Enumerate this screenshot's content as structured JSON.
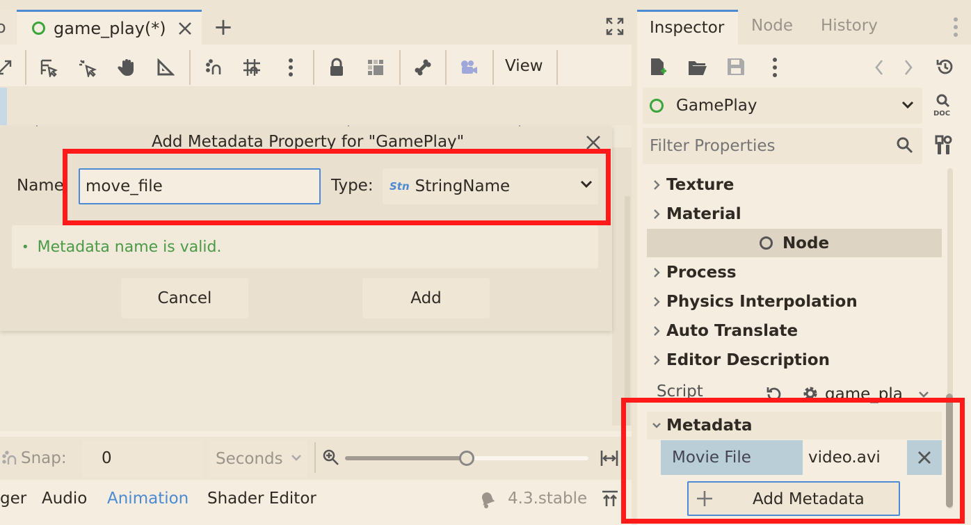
{
  "tabs": {
    "scene_tab": "game_play(*)",
    "add_tab": "+"
  },
  "toolbar": {
    "view_label": "View"
  },
  "dialog": {
    "title": "Add Metadata Property for \"GamePlay\"",
    "name_label": "Name:",
    "name_value": "move_file",
    "type_label": "Type:",
    "type_value": "StringName",
    "validation": "Metadata name is valid.",
    "cancel": "Cancel",
    "add": "Add"
  },
  "animation_bar": {
    "snap_label": "Snap:",
    "snap_value": "0",
    "unit": "Seconds"
  },
  "bottom_tabs": [
    "ger",
    "Audio",
    "Animation",
    "Shader Editor"
  ],
  "version": "4.3.stable",
  "inspector": {
    "tabs": [
      "Inspector",
      "Node",
      "History"
    ],
    "object": "GamePlay",
    "filter_placeholder": "Filter Properties",
    "sections": [
      "Texture",
      "Material"
    ],
    "node_header": "Node",
    "node_sections": [
      "Process",
      "Physics Interpolation",
      "Auto Translate",
      "Editor Description"
    ],
    "script_label": "Script",
    "script_value": "game_pla",
    "metadata_header": "Metadata",
    "meta_key": "Movie File",
    "meta_value": "video.avi",
    "add_metadata": "Add Metadata"
  },
  "colors": {
    "accent": "#4c8ad4",
    "highlight": "#ff1a1a",
    "valid": "#4a9a46",
    "node_green": "#3aa53a"
  }
}
